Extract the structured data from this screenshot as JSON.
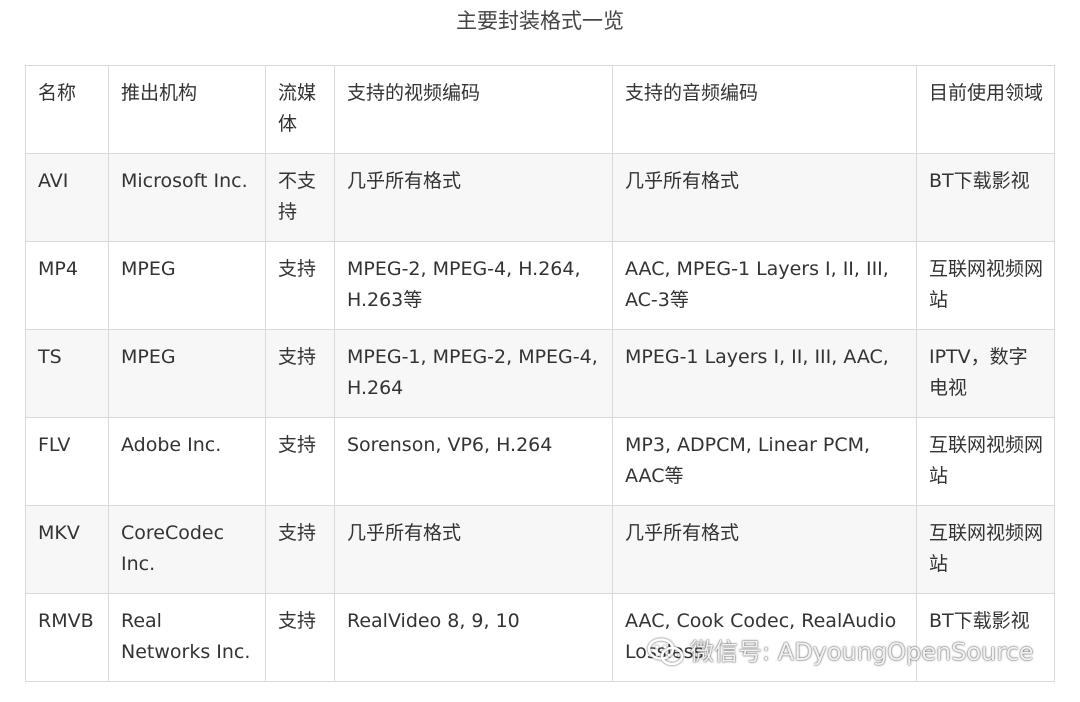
{
  "caption": "主要封装格式一览",
  "table": {
    "rows": [
      [
        "名称",
        "推出机构",
        "流媒体",
        "支持的视频编码",
        "支持的音频编码",
        "目前使用领域"
      ],
      [
        "AVI",
        "Microsoft Inc.",
        "不支持",
        "几乎所有格式",
        "几乎所有格式",
        "BT下载影视"
      ],
      [
        "MP4",
        "MPEG",
        "支持",
        "MPEG-2, MPEG-4, H.264, H.263等",
        "AAC, MPEG-1 Layers I, II, III, AC-3等",
        "互联网视频网站"
      ],
      [
        "TS",
        "MPEG",
        "支持",
        "MPEG-1, MPEG-2, MPEG-4, H.264",
        "MPEG-1 Layers I, II, III, AAC,",
        "IPTV，数字电视"
      ],
      [
        "FLV",
        "Adobe Inc.",
        "支持",
        "Sorenson, VP6, H.264",
        "MP3, ADPCM, Linear PCM, AAC等",
        "互联网视频网站"
      ],
      [
        "MKV",
        "CoreCodec Inc.",
        "支持",
        "几乎所有格式",
        "几乎所有格式",
        "互联网视频网站"
      ],
      [
        "RMVB",
        "Real Networks Inc.",
        "支持",
        "RealVideo 8, 9, 10",
        "AAC, Cook Codec, RealAudio Lossless",
        "BT下载影视"
      ]
    ]
  },
  "watermark": {
    "icon": "wechat-icon",
    "text": "微信号: ADyoungOpenSource"
  }
}
